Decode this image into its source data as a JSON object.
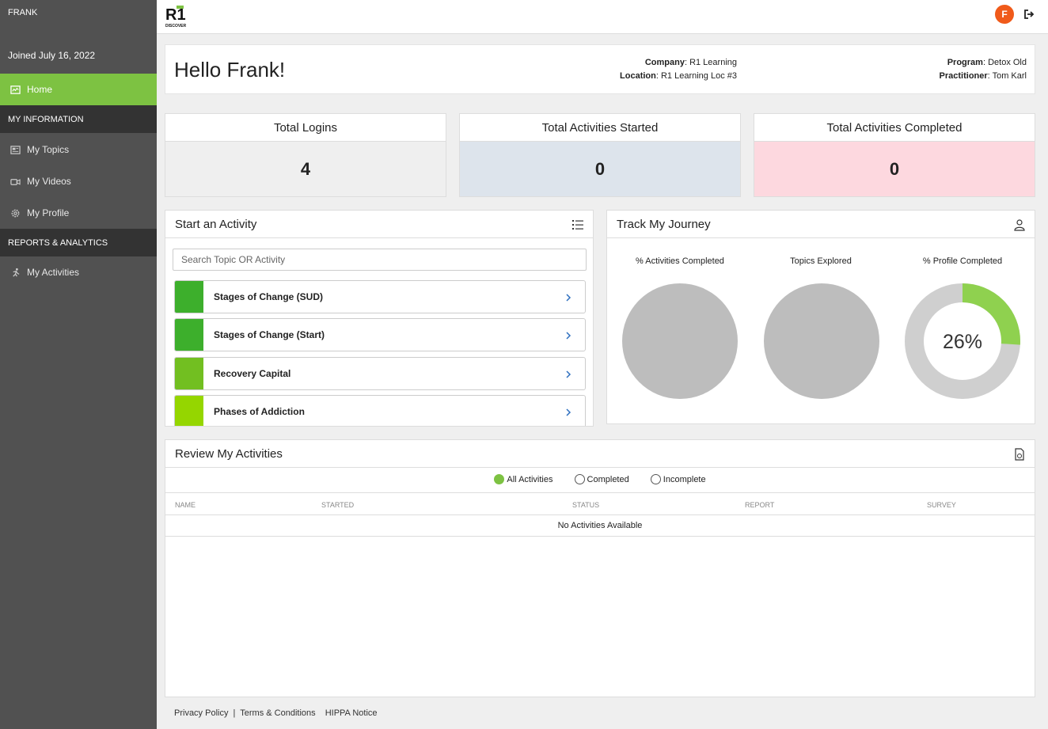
{
  "sidebar": {
    "user": "FRANK",
    "joined": "Joined July 16, 2022",
    "home_label": "Home",
    "section_info": "MY INFORMATION",
    "topics_label": "My Topics",
    "videos_label": "My Videos",
    "profile_label": "My Profile",
    "section_reports": "REPORTS & ANALYTICS",
    "activities_label": "My Activities"
  },
  "topbar": {
    "logo_text": "R1",
    "logo_subtext": "DISCOVER",
    "avatar_initial": "F"
  },
  "hello": {
    "greeting": "Hello Frank!",
    "company_label": "Company",
    "company": "R1 Learning",
    "location_label": "Location",
    "location": "R1 Learning Loc #3",
    "program_label": "Program",
    "program": "Detox Old",
    "practitioner_label": "Practitioner",
    "practitioner": "Tom Karl"
  },
  "stats": [
    {
      "title": "Total Logins",
      "value": "4",
      "bg": "#efefef"
    },
    {
      "title": "Total Activities Started",
      "value": "0",
      "bg": "#dde4ec"
    },
    {
      "title": "Total Activities Completed",
      "value": "0",
      "bg": "#fdd8df"
    }
  ],
  "start_activity": {
    "title": "Start an Activity",
    "search_placeholder": "Search Topic OR Activity",
    "items": [
      {
        "label": "Stages of Change (SUD)",
        "color": "#3daf2c"
      },
      {
        "label": "Stages of Change (Start)",
        "color": "#3daf2c"
      },
      {
        "label": "Recovery Capital",
        "color": "#72bf21"
      },
      {
        "label": "Phases of Addiction",
        "color": "#95d600"
      }
    ]
  },
  "journey": {
    "title": "Track My Journey",
    "charts": [
      {
        "label": "% Activities Completed",
        "percent": 0
      },
      {
        "label": "Topics Explored",
        "percent": 0
      },
      {
        "label": "% Profile Completed",
        "percent": 26,
        "display": "26%"
      }
    ],
    "accent_color": "#8fd14f",
    "empty_color": "#bdbdbd"
  },
  "review": {
    "title": "Review My Activities",
    "filters": [
      "All Activities",
      "Completed",
      "Incomplete"
    ],
    "selected_filter": "All Activities",
    "columns": [
      "NAME",
      "STARTED",
      "STATUS",
      "REPORT",
      "SURVEY"
    ],
    "empty_text": "No Activities Available"
  },
  "footer": {
    "privacy": "Privacy Policy",
    "sep": "|",
    "terms": "Terms & Conditions",
    "hippa": "HIPPA Notice"
  }
}
